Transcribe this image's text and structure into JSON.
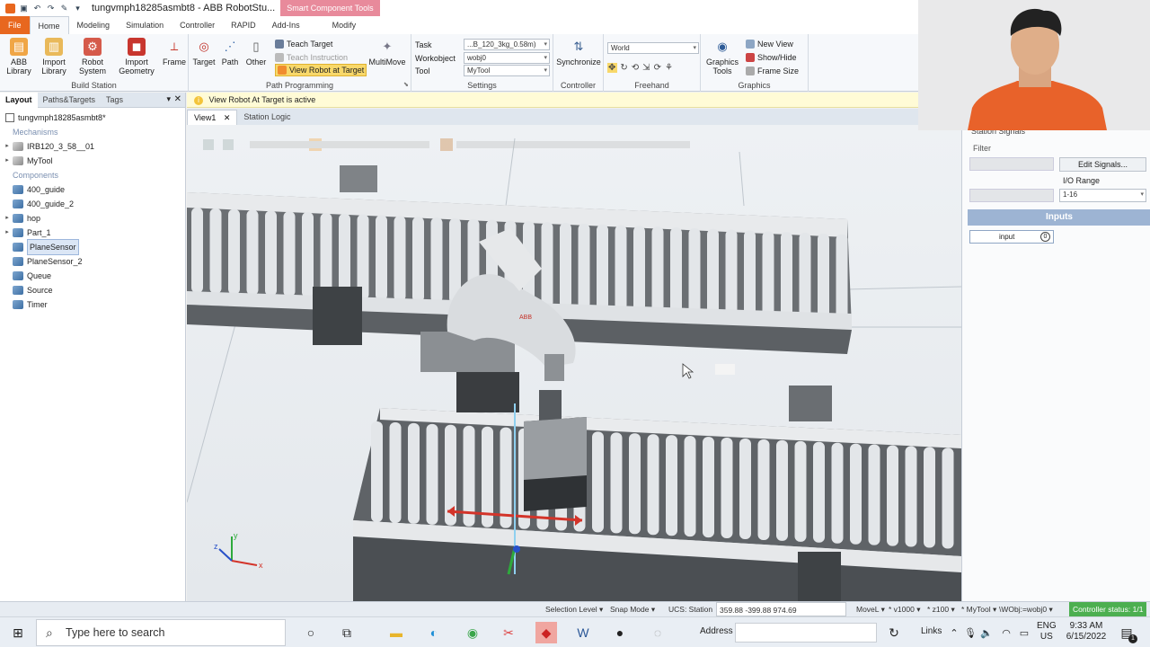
{
  "window": {
    "title": "tungvmph18285asmbt8 - ABB RobotStu...",
    "context_tab_label": "Smart Component Tools"
  },
  "ribbon_tabs": [
    "File",
    "Home",
    "Modeling",
    "Simulation",
    "Controller",
    "RAPID",
    "Add-Ins",
    "Modify"
  ],
  "ribbon": {
    "build_station": {
      "label": "Build Station",
      "buttons": [
        "ABB Library",
        "Import Library",
        "Robot System",
        "Import Geometry",
        "Frame"
      ]
    },
    "path_programming": {
      "label": "Path Programming",
      "buttons": [
        "Target",
        "Path",
        "Other"
      ],
      "small": [
        "Teach Target",
        "Teach Instruction",
        "View Robot at Target"
      ],
      "multimove": "MultiMove"
    },
    "settings": {
      "label": "Settings",
      "task_label": "Task",
      "task_value": "...B_120_3kg_0.58m)",
      "workobject_label": "Workobject",
      "workobject_value": "wobj0",
      "tool_label": "Tool",
      "tool_value": "MyTool"
    },
    "controller": {
      "label": "Controller",
      "button": "Synchronize"
    },
    "freehand": {
      "label": "Freehand",
      "frame_value": "World"
    },
    "graphics": {
      "label": "Graphics",
      "button": "Graphics Tools",
      "small": [
        "New View",
        "Show/Hide",
        "Frame Size"
      ]
    }
  },
  "left_panel": {
    "tabs": [
      "Layout",
      "Paths&Targets",
      "Tags"
    ],
    "root": "tungvmph18285asmbt8*",
    "mechanisms_label": "Mechanisms",
    "mechanisms": [
      "IRB120_3_58__01",
      "MyTool"
    ],
    "components_label": "Components",
    "components": [
      {
        "name": "400_guide",
        "expandable": false
      },
      {
        "name": "400_guide_2",
        "expandable": false
      },
      {
        "name": "hop",
        "expandable": true
      },
      {
        "name": "Part_1",
        "expandable": true
      },
      {
        "name": "PlaneSensor",
        "expandable": false,
        "selected": true
      },
      {
        "name": "PlaneSensor_2",
        "expandable": false
      },
      {
        "name": "Queue",
        "expandable": false
      },
      {
        "name": "Source",
        "expandable": false
      },
      {
        "name": "Timer",
        "expandable": false
      }
    ]
  },
  "info_bar": "View Robot At Target is active",
  "doc_tabs": [
    "View1",
    "Station Logic"
  ],
  "right_panel": {
    "header": "Station Signals",
    "filter_label": "Filter",
    "edit_signals": "Edit Signals...",
    "io_range_label": "I/O Range",
    "io_range_value": "1-16",
    "inputs_header": "Inputs",
    "input_name": "input",
    "input_value": "0"
  },
  "status_bar": {
    "selection_level": "Selection Level",
    "snap_mode": "Snap Mode",
    "ucs": "UCS: Station",
    "coords": "359.88  -399.88  974.69",
    "move": "MoveL",
    "speed": "v1000",
    "zone": "z100",
    "tool": "MyTool",
    "wobj": "\\WObj:=wobj0",
    "controller_status": "Controller status: 1/1"
  },
  "taskbar": {
    "search_placeholder": "Type here to search",
    "address_label": "Address",
    "links_label": "Links",
    "lang_top": "ENG",
    "lang_bottom": "US",
    "time": "9:33 AM",
    "date": "6/15/2022",
    "notification_count": "1"
  },
  "colors": {
    "file_tab": "#e8671f",
    "context_tab": "#e88a9b",
    "inputs_header": "#9db4d3",
    "controller_ok": "#4caf50"
  }
}
